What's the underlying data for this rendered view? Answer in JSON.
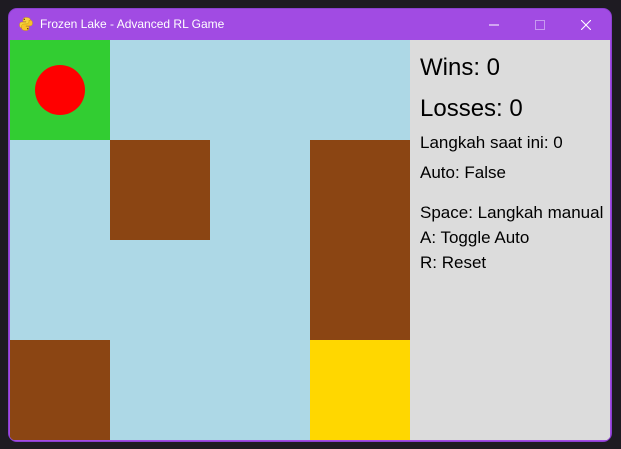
{
  "window": {
    "title": "Frozen Lake - Advanced RL Game",
    "icon": "pygame-snake-icon",
    "accent_color": "#a14be3"
  },
  "board": {
    "rows": 4,
    "cols": 4,
    "colors": {
      "start": "#32cd32",
      "ice": "#add8e6",
      "hole": "#8b4513",
      "goal": "#ffd700",
      "agent": "#ff0000"
    },
    "tiles": [
      [
        "start",
        "ice",
        "ice",
        "ice"
      ],
      [
        "ice",
        "hole",
        "ice",
        "hole"
      ],
      [
        "ice",
        "ice",
        "ice",
        "hole"
      ],
      [
        "hole",
        "ice",
        "ice",
        "goal"
      ]
    ],
    "agent": {
      "row": 0,
      "col": 0
    }
  },
  "stats": {
    "wins": "Wins: 0",
    "losses": "Losses: 0",
    "current_step": "Langkah saat ini: 0",
    "auto": "Auto: False"
  },
  "controls": {
    "space": "Space: Langkah manual",
    "a": "A: Toggle Auto",
    "r": "R: Reset"
  }
}
